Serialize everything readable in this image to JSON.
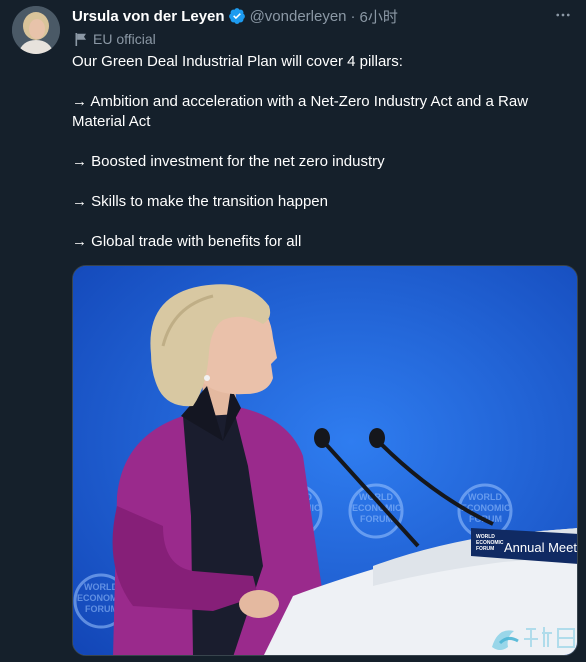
{
  "tweet": {
    "display_name": "Ursula von der Leyen",
    "handle": "@vonderleyen",
    "separator": "·",
    "time": "6小时",
    "label": "EU official",
    "paragraphs": [
      "Our Green Deal Industrial Plan will cover 4 pillars:",
      "→ Ambition and acceleration with a Net-Zero Industry Act and a Raw Material Act",
      "→ Boosted investment for the net zero industry",
      "→ Skills to make the transition happen",
      "→ Global trade with benefits for all"
    ]
  },
  "media": {
    "backdrop_logo_lines": [
      "WORLD",
      "ECONOMIC",
      "FORUM"
    ],
    "podium_logo_lines": [
      "WORLD",
      "ECONOMIC",
      "FORUM"
    ],
    "podium_banner": "Annual Meeting"
  },
  "colors": {
    "background": "#15202b",
    "secondary_text": "#8b98a5",
    "verified": "#1d9bf0",
    "wef_blue": "#1f5fd6",
    "jacket": "#9a2a8c"
  },
  "icons": {
    "verified": "verified-badge-icon",
    "more": "more-options-icon",
    "label": "flag-icon"
  }
}
